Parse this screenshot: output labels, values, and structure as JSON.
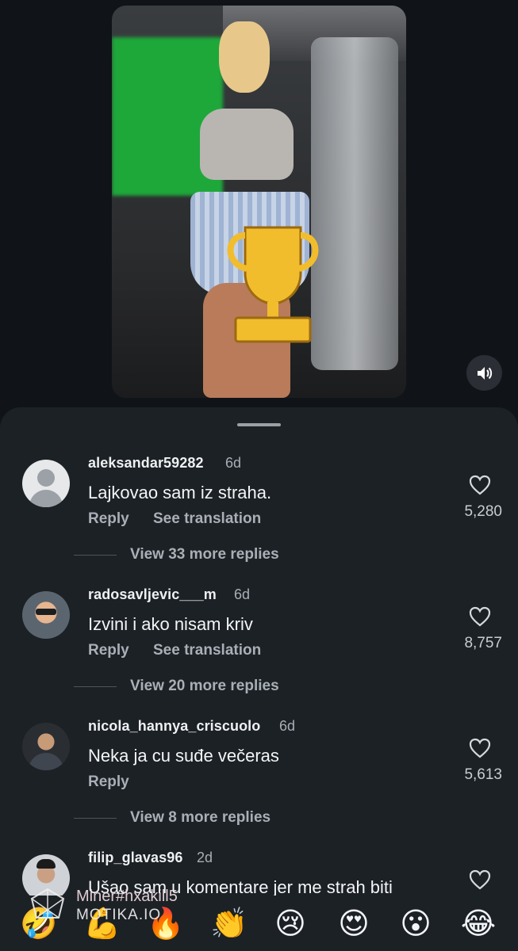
{
  "video": {
    "overlay_icon": "trophy-icon",
    "volume_icon": "speaker-icon"
  },
  "comments": [
    {
      "username": "aleksandar59282",
      "time": "6d",
      "text": "Lajkovao sam iz straha.",
      "reply_label": "Reply",
      "translate_label": "See translation",
      "likes": "5,280",
      "more_replies": "View 33 more replies",
      "avatar": "default-avatar"
    },
    {
      "username": "radosavljevic___m",
      "time": "6d",
      "text": "Izvini i ako nisam kriv",
      "reply_label": "Reply",
      "translate_label": "See translation",
      "likes": "8,757",
      "more_replies": "View 20 more replies",
      "avatar": "photo-avatar"
    },
    {
      "username": "nicola_hannya_criscuolo",
      "time": "6d",
      "text": "Neka ja cu suđe večeras",
      "reply_label": "Reply",
      "likes": "5,613",
      "more_replies": "View 8 more replies",
      "avatar": "photo-avatar"
    },
    {
      "username": "filip_glavas96",
      "time": "2d",
      "text": "Ušao sam u komentare jer me strah biti",
      "avatar": "photo-avatar"
    }
  ],
  "emoji_bar": [
    "🤣",
    "💪",
    "🔥",
    "👏",
    "😢",
    "😍",
    "😮",
    "😂"
  ],
  "watermark": {
    "line1": "Miner#hxakill5",
    "line2": "MOTIKA.IO"
  }
}
